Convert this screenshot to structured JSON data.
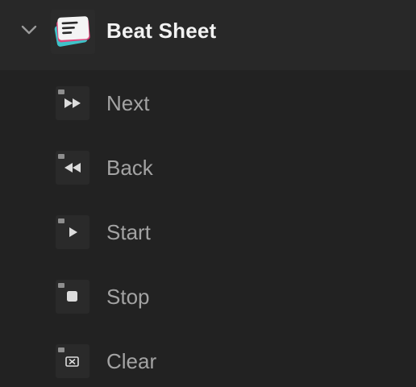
{
  "group": {
    "title": "Beat Sheet",
    "expanded": true,
    "icon": "beat-sheet-app-icon",
    "chevron_icon": "chevron-down-icon"
  },
  "items": [
    {
      "label": "Next",
      "icon": "fast-forward-icon"
    },
    {
      "label": "Back",
      "icon": "rewind-icon"
    },
    {
      "label": "Start",
      "icon": "play-icon"
    },
    {
      "label": "Stop",
      "icon": "stop-icon"
    },
    {
      "label": "Clear",
      "icon": "clear-icon"
    }
  ],
  "colors": {
    "background": "#222222",
    "header_background": "#282828",
    "title_text": "#f2f2f2",
    "item_text": "#a3a3a3",
    "card_pink": "#e0457b",
    "card_teal": "#3fc3c9",
    "card_white": "#f4f4f4"
  }
}
